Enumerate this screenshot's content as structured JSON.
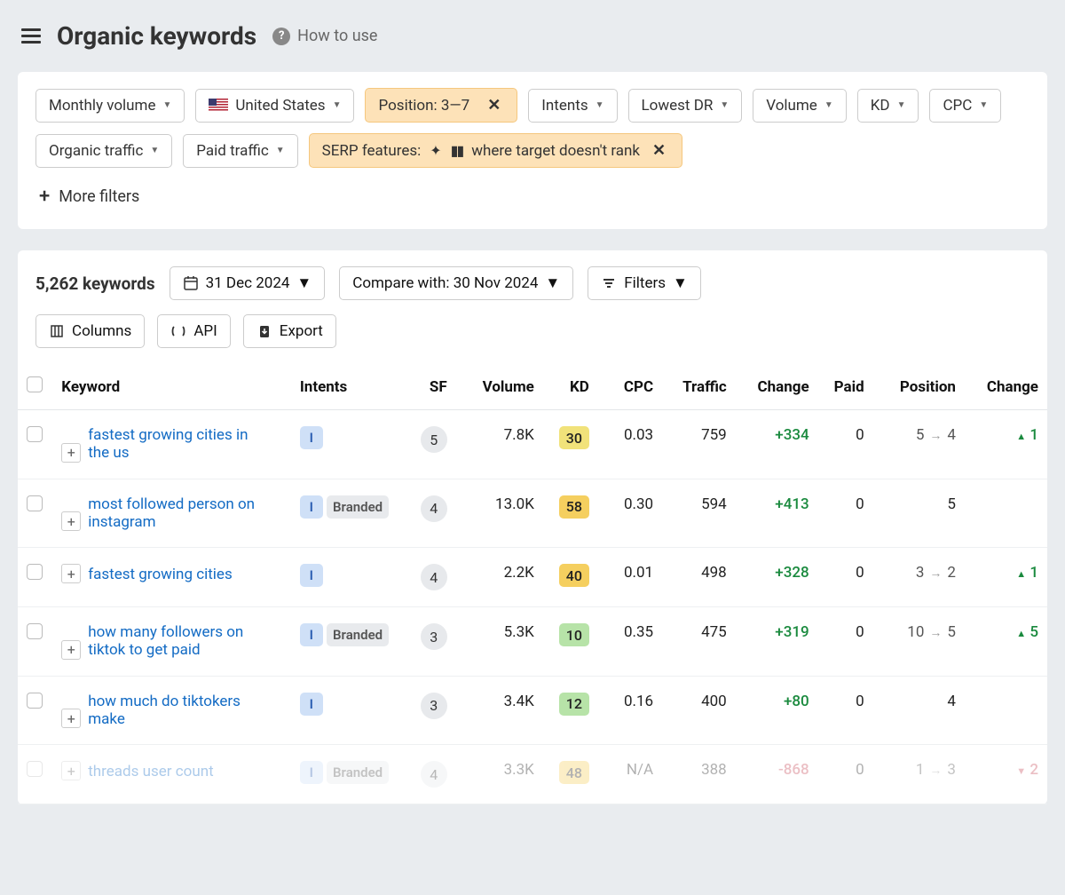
{
  "header": {
    "title": "Organic keywords",
    "help": "How to use"
  },
  "filters": {
    "monthly_volume": "Monthly volume",
    "country": "United States",
    "position": "Position: 3—7",
    "intents": "Intents",
    "lowest_dr": "Lowest DR",
    "volume": "Volume",
    "kd": "KD",
    "cpc": "CPC",
    "organic_traffic": "Organic traffic",
    "paid_traffic": "Paid traffic",
    "serp_features_prefix": "SERP features:",
    "serp_features_suffix": "where target doesn't rank",
    "more_filters": "More filters"
  },
  "toolbar": {
    "count": "5,262 keywords",
    "date": "31 Dec 2024",
    "compare": "Compare with: 30 Nov 2024",
    "filters": "Filters",
    "columns": "Columns",
    "api": "API",
    "export": "Export"
  },
  "columns": {
    "keyword": "Keyword",
    "intents": "Intents",
    "sf": "SF",
    "volume": "Volume",
    "kd": "KD",
    "cpc": "CPC",
    "traffic": "Traffic",
    "change": "Change",
    "paid": "Paid",
    "position": "Position",
    "pos_change": "Change"
  },
  "intent_labels": {
    "i": "I",
    "branded": "Branded"
  },
  "rows": [
    {
      "keyword": "fastest growing cities in the us",
      "intents": [
        "i"
      ],
      "sf": "5",
      "volume": "7.8K",
      "kd": "30",
      "kd_class": "kd-yellow",
      "cpc": "0.03",
      "traffic": "759",
      "change": "+334",
      "change_class": "change-pos",
      "paid": "0",
      "pos_from": "5",
      "pos_to": "4",
      "pos_delta": "1",
      "pos_dir": "up"
    },
    {
      "keyword": "most followed person on instagram",
      "intents": [
        "i",
        "branded"
      ],
      "sf": "4",
      "volume": "13.0K",
      "kd": "58",
      "kd_class": "kd-orange",
      "cpc": "0.30",
      "traffic": "594",
      "change": "+413",
      "change_class": "change-pos",
      "paid": "0",
      "pos_from": "",
      "pos_to": "5",
      "pos_delta": "",
      "pos_dir": ""
    },
    {
      "keyword": "fastest growing cities",
      "intents": [
        "i"
      ],
      "sf": "4",
      "volume": "2.2K",
      "kd": "40",
      "kd_class": "kd-orange",
      "cpc": "0.01",
      "traffic": "498",
      "change": "+328",
      "change_class": "change-pos",
      "paid": "0",
      "pos_from": "3",
      "pos_to": "2",
      "pos_delta": "1",
      "pos_dir": "up"
    },
    {
      "keyword": "how many followers on tiktok to get paid",
      "intents": [
        "i",
        "branded"
      ],
      "sf": "3",
      "volume": "5.3K",
      "kd": "10",
      "kd_class": "kd-green",
      "cpc": "0.35",
      "traffic": "475",
      "change": "+319",
      "change_class": "change-pos",
      "paid": "0",
      "pos_from": "10",
      "pos_to": "5",
      "pos_delta": "5",
      "pos_dir": "up"
    },
    {
      "keyword": "how much do tiktokers make",
      "intents": [
        "i"
      ],
      "sf": "3",
      "volume": "3.4K",
      "kd": "12",
      "kd_class": "kd-green",
      "cpc": "0.16",
      "traffic": "400",
      "change": "+80",
      "change_class": "change-pos",
      "paid": "0",
      "pos_from": "",
      "pos_to": "4",
      "pos_delta": "",
      "pos_dir": ""
    },
    {
      "keyword": "threads user count",
      "intents": [
        "i",
        "branded"
      ],
      "sf": "4",
      "volume": "3.3K",
      "kd": "48",
      "kd_class": "kd-orange",
      "cpc": "N/A",
      "traffic": "388",
      "change": "-868",
      "change_class": "change-neg",
      "paid": "0",
      "pos_from": "1",
      "pos_to": "3",
      "pos_delta": "2",
      "pos_dir": "down",
      "fade": true
    }
  ]
}
